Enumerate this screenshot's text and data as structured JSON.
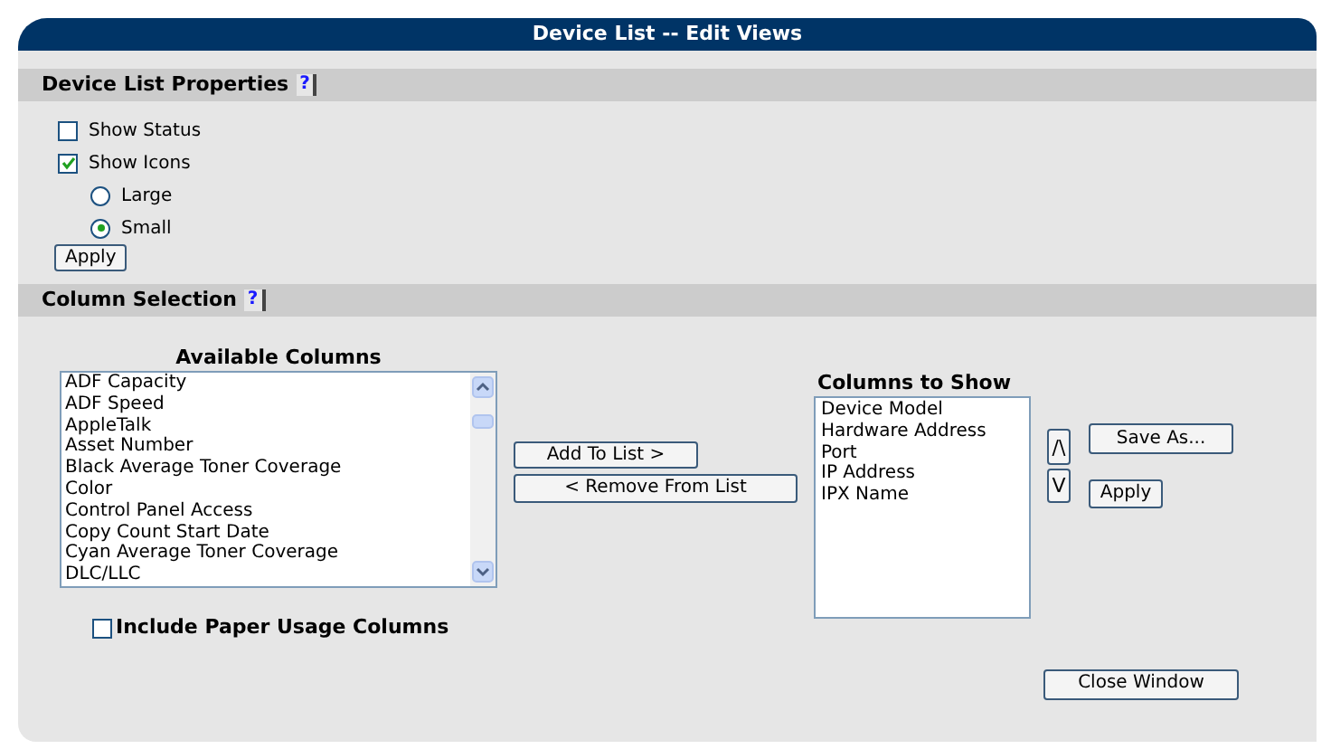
{
  "window": {
    "title": "Device List -- Edit Views"
  },
  "properties": {
    "heading": "Device List Properties",
    "help": "?",
    "options": [
      {
        "kind": "checkbox",
        "label": "Show Status",
        "checked": false
      },
      {
        "kind": "checkbox",
        "label": "Show Icons",
        "checked": true
      },
      {
        "kind": "radio",
        "label": "Large",
        "selected": false
      },
      {
        "kind": "radio",
        "label": "Small",
        "selected": true
      }
    ],
    "apply": "Apply"
  },
  "column_selection": {
    "heading": "Column Selection",
    "help": "?",
    "available": {
      "heading": "Available Columns",
      "items": [
        "ADF Capacity",
        "ADF Speed",
        "AppleTalk",
        "Asset Number",
        "Black Average Toner Coverage",
        "Color",
        "Control Panel Access",
        "Copy Count Start Date",
        "Cyan Average Toner Coverage",
        "DLC/LLC"
      ]
    },
    "add": "Add To List >",
    "remove": "< Remove From List",
    "to_show": {
      "heading": "Columns to Show",
      "items": [
        "Device Model",
        "Hardware Address",
        "Port",
        "IP Address",
        "IPX Name"
      ]
    },
    "up": "/\\",
    "down": "V",
    "save_as": "Save As...",
    "apply": "Apply",
    "include_paper": {
      "label": "Include Paper Usage Columns",
      "checked": false
    }
  },
  "close": "Close Window"
}
